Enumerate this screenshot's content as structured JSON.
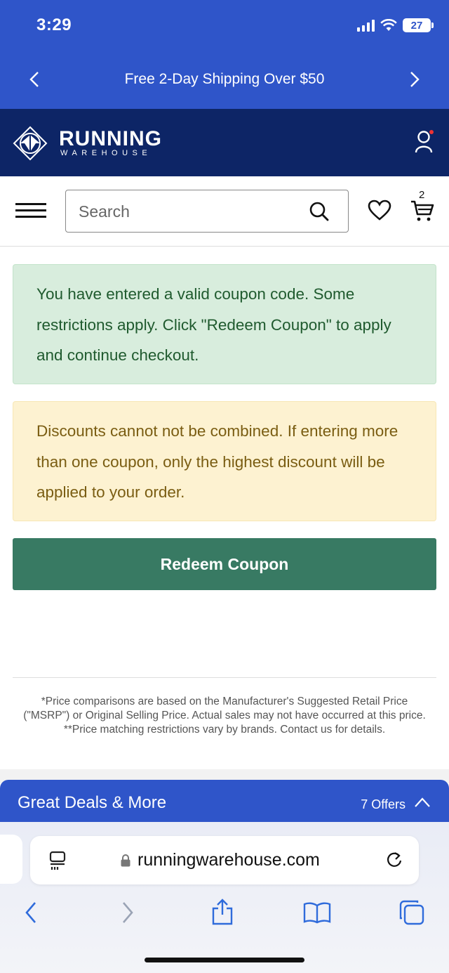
{
  "status_bar": {
    "time": "3:29",
    "battery": "27"
  },
  "promo": {
    "text": "Free 2-Day Shipping Over $50"
  },
  "brand": {
    "name": "RUNNING",
    "sub": "WAREHOUSE"
  },
  "search": {
    "placeholder": "Search"
  },
  "cart": {
    "count": "2"
  },
  "alerts": {
    "success": "You have entered a valid coupon code. Some restrictions apply. Click \"Redeem Coupon\" to apply and continue checkout.",
    "warning": "Discounts cannot not be combined. If entering more than one coupon, only the highest discount will be applied to your order."
  },
  "redeem_button": {
    "label": "Redeem Coupon"
  },
  "footnote": {
    "line1": "*Price comparisons are based on the Manufacturer's Suggested Retail Price (\"MSRP\") or Original Selling Price. Actual sales may not have occurred at this price.",
    "line2": "**Price matching restrictions vary by brands. Contact us for details."
  },
  "deals": {
    "title": "Great Deals & More",
    "offers": "7 Offers"
  },
  "browser": {
    "url": "runningwarehouse.com"
  },
  "colors": {
    "brand_blue": "#2f55c9",
    "navy": "#0d2566",
    "success_bg": "#d8eddd",
    "warning_bg": "#fdf2d1",
    "button_green": "#387a63"
  },
  "icons": [
    "chevron-left-icon",
    "chevron-right-icon",
    "account-icon",
    "menu-icon",
    "search-icon",
    "heart-icon",
    "cart-icon",
    "chevron-up-icon",
    "reader-icon",
    "lock-icon",
    "reload-icon",
    "back-icon",
    "forward-icon",
    "share-icon",
    "bookmarks-icon",
    "tabs-icon"
  ]
}
